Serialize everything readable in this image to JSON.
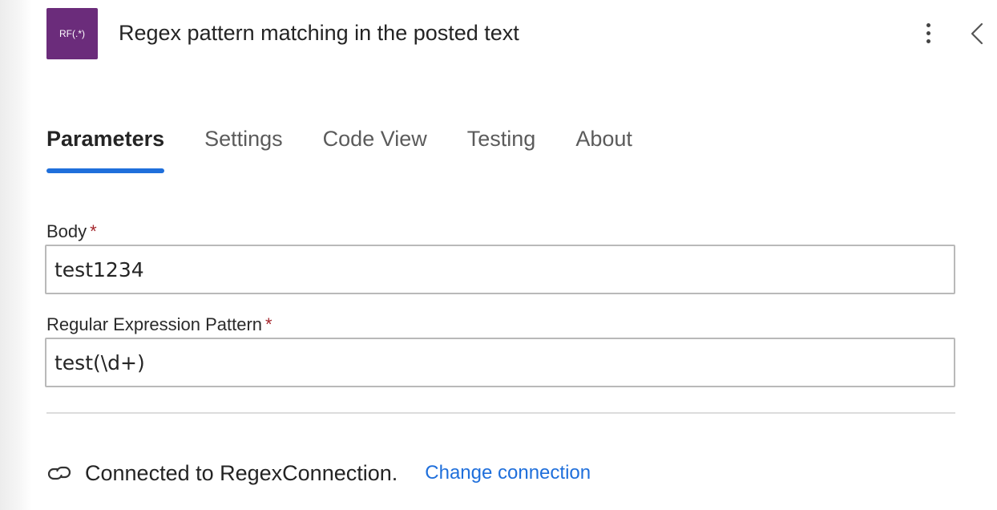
{
  "header": {
    "icon_text": "RF(.*)",
    "title": "Regex pattern matching in the posted text",
    "icon_color": "#6b2c7b"
  },
  "tabs": [
    {
      "label": "Parameters",
      "active": true
    },
    {
      "label": "Settings",
      "active": false
    },
    {
      "label": "Code View",
      "active": false
    },
    {
      "label": "Testing",
      "active": false
    },
    {
      "label": "About",
      "active": false
    }
  ],
  "fields": {
    "body": {
      "label": "Body",
      "required": "*",
      "value": "test1234"
    },
    "pattern": {
      "label": "Regular Expression Pattern",
      "required": "*",
      "value": "test(\\d+)"
    }
  },
  "connection": {
    "icon": "link-icon",
    "text": "Connected to RegexConnection.",
    "change_label": "Change connection"
  },
  "colors": {
    "accent": "#1f6fdb",
    "required": "#a4262c"
  }
}
